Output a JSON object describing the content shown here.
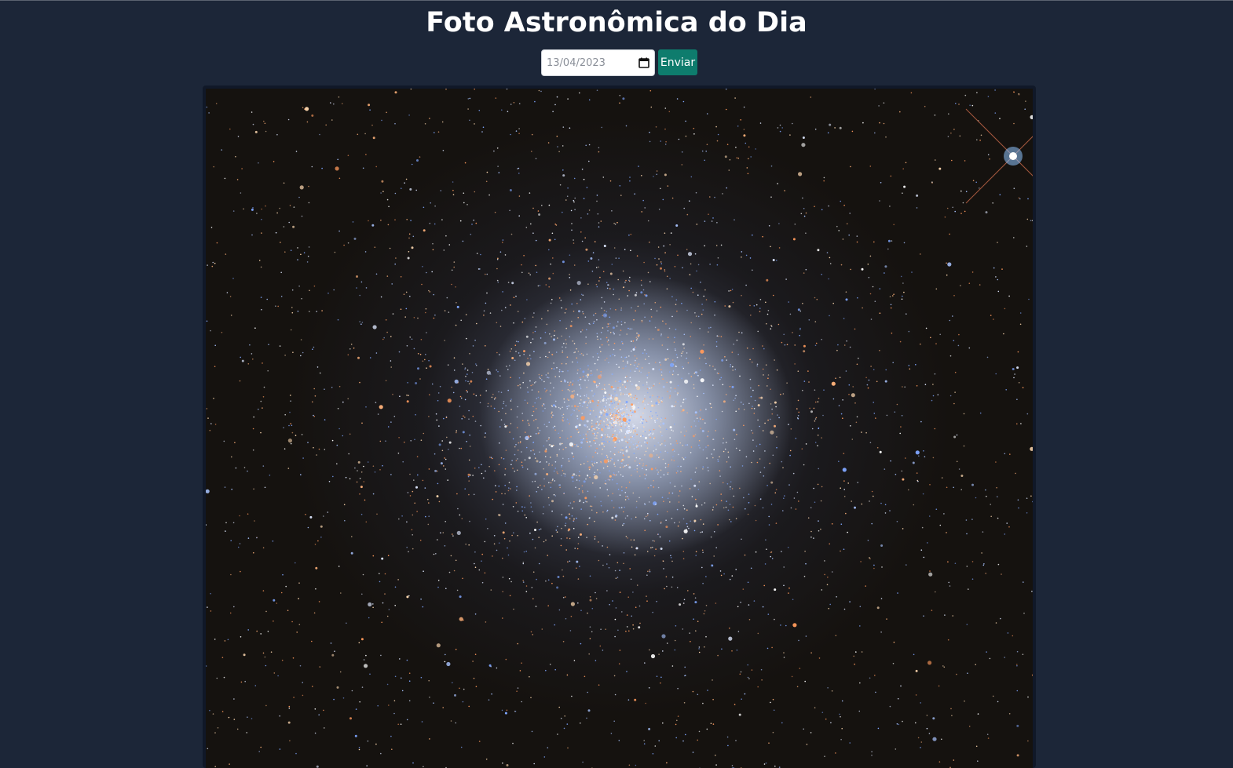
{
  "page": {
    "title": "Foto Astronômica do Dia"
  },
  "form": {
    "date_value": "13/04/2023",
    "submit_label": "Enviar"
  },
  "photo": {
    "subject": "star cluster"
  },
  "colors": {
    "background": "#1c2638",
    "button": "#0e7c6d",
    "title": "#ffffff"
  },
  "icons": {
    "date_picker": "calendar-icon"
  }
}
